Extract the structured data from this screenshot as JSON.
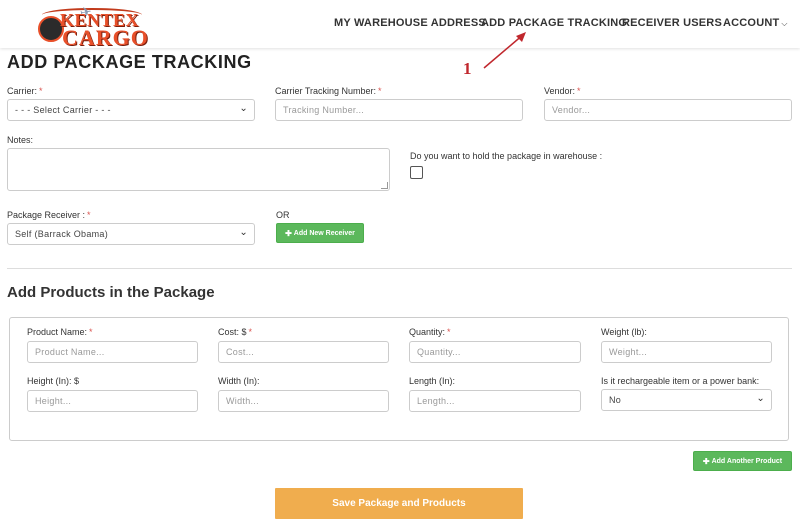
{
  "header": {
    "logo_top": "KENTEX",
    "logo_bottom": "CARGO",
    "nav": [
      {
        "label": "MY WAREHOUSE ADDRESS"
      },
      {
        "label": "ADD PACKAGE TRACKING"
      },
      {
        "label": "RECEIVER USERS"
      },
      {
        "label": "ACCOUNT"
      }
    ]
  },
  "annotation": {
    "number": "1",
    "color": "#c0272d"
  },
  "page": {
    "title": "ADD PACKAGE TRACKING"
  },
  "form": {
    "carrier": {
      "label": "Carrier:",
      "value": "- - - Select Carrier - - -"
    },
    "tracking": {
      "label": "Carrier Tracking Number:",
      "placeholder": "Tracking Number..."
    },
    "vendor": {
      "label": "Vendor:",
      "placeholder": "Vendor..."
    },
    "notes": {
      "label": "Notes:"
    },
    "hold": {
      "label": "Do you want to hold the package in warehouse :",
      "checked": false
    },
    "receiver": {
      "label": "Package Receiver :",
      "value": "Self (Barrack Obama)"
    },
    "or_text": "OR",
    "add_receiver_button": "Add New Receiver"
  },
  "products": {
    "section_title": "Add Products in the Package",
    "product_name": {
      "label": "Product Name:",
      "placeholder": "Product Name..."
    },
    "cost": {
      "label": "Cost: $",
      "placeholder": "Cost..."
    },
    "quantity": {
      "label": "Quantity:",
      "placeholder": "Quantity..."
    },
    "weight": {
      "label": "Weight (lb):",
      "placeholder": "Weight..."
    },
    "height": {
      "label": "Height (In): $",
      "placeholder": "Height..."
    },
    "width": {
      "label": "Width (In):",
      "placeholder": "Width..."
    },
    "length": {
      "label": "Length (In):",
      "placeholder": "Length..."
    },
    "rechargeable": {
      "label": "Is it rechargeable item or a power bank:",
      "value": "No"
    },
    "add_another_button": "Add Another Product"
  },
  "save_button": "Save Package and Products",
  "colors": {
    "accent_green": "#5cb85c",
    "save_orange": "#f0ad4e",
    "required_red": "#d9534f",
    "logo_orange": "#e8502a"
  }
}
